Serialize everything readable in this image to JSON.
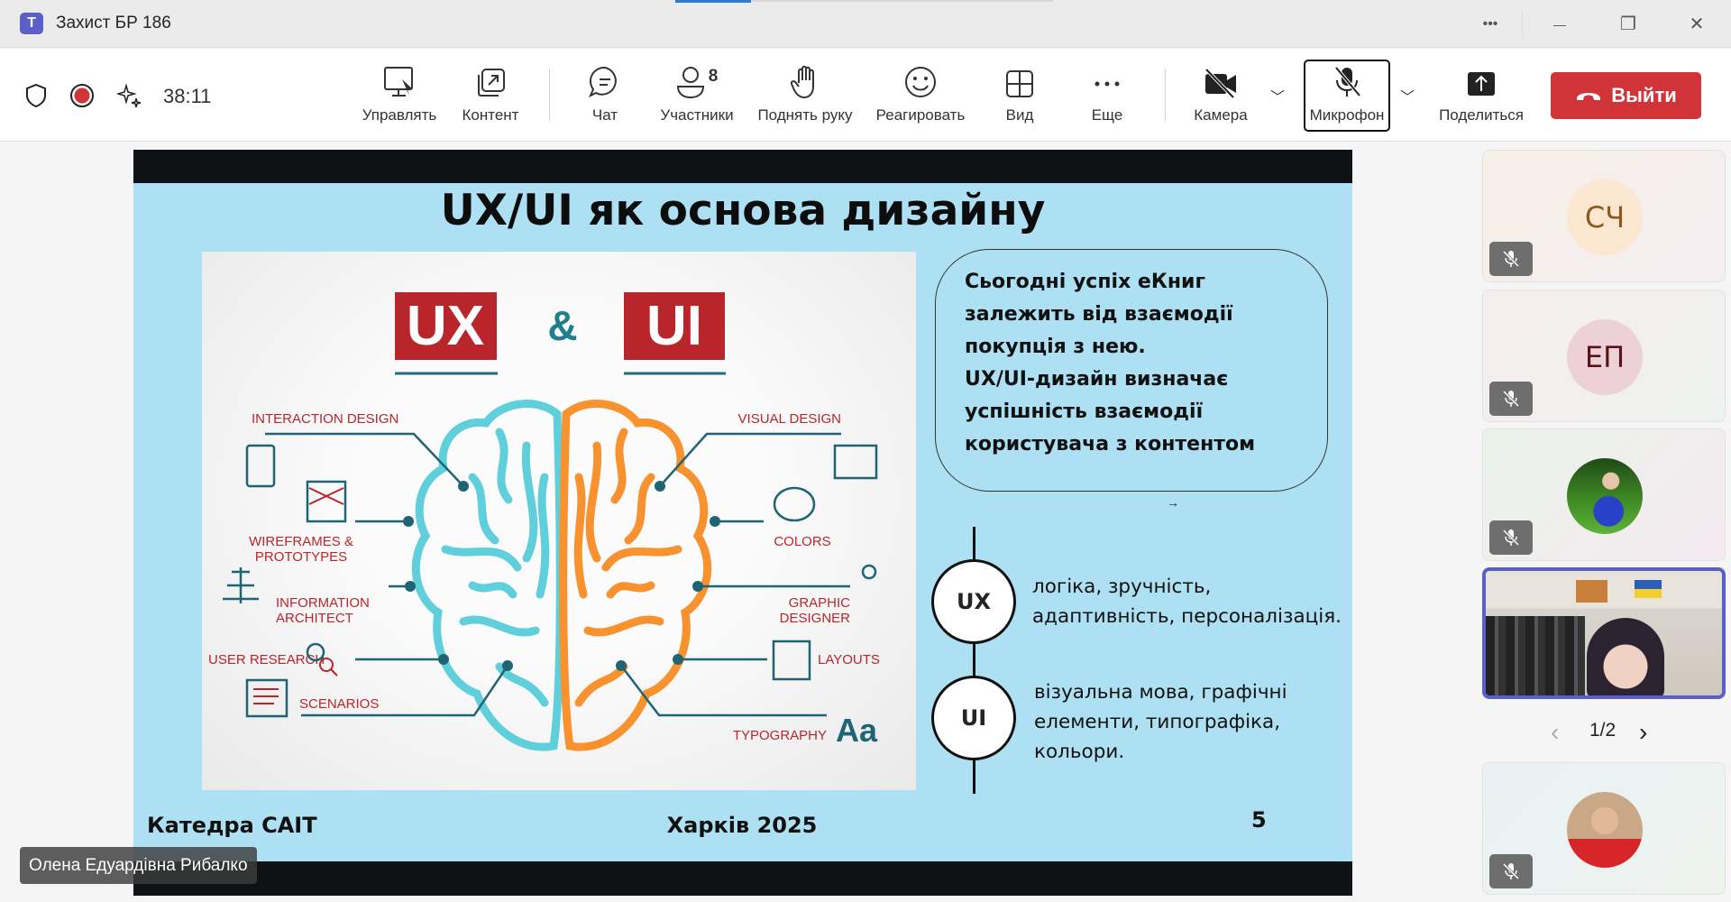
{
  "window": {
    "title": "Захист БР 186",
    "menu": "•••",
    "minimize": "—",
    "restore": "❐",
    "close": "✕"
  },
  "toolbar": {
    "timer": "38:11",
    "manage": "Управлять",
    "content": "Контент",
    "chat": "Чат",
    "participants": "Участники",
    "participants_count": "8",
    "raise_hand": "Поднять руку",
    "react": "Реагировать",
    "view": "Вид",
    "more": "Еще",
    "camera": "Камера",
    "microphone": "Микрофон",
    "share": "Поделиться",
    "leave": "Выйти"
  },
  "slide": {
    "title": "UX/UI як основа дизайну",
    "infographic": {
      "ux": "UX",
      "amp": "&",
      "ui": "UI",
      "labels": {
        "interaction": "INTERACTION DESIGN",
        "wireframes1": "WIREFRAMES &",
        "wireframes2": "PROTOTYPES",
        "info1": "INFORMATION",
        "info2": "ARCHITECT",
        "user_research": "USER RESEARCH",
        "scenarios": "SCENARIOS",
        "visual": "VISUAL DESIGN",
        "colors": "COLORS",
        "graphic1": "GRAPHIC",
        "graphic2": "DESIGNER",
        "layouts": "LAYOUTS",
        "typography": "TYPOGRAPHY",
        "aa": "Aa"
      },
      "colors": {
        "ux_brain": "#5fcfdc",
        "ui_brain": "#f7922f",
        "red": "#b8262c",
        "teal": "#1f6473"
      }
    },
    "box_lines": [
      "Сьогодні успіх еКниг",
      "залежить від взаємодії",
      "покупція з нею.",
      "UX/UI-дизайн визначає",
      "успішність взаємодії",
      "користувача з контентом"
    ],
    "arrow": "→",
    "ux": {
      "label": "UX",
      "lines": [
        " логіка, зручність,",
        "адаптивність, персоналізація."
      ]
    },
    "ui": {
      "label": "UI",
      "lines": [
        "візуальна мова, графічні",
        "елементи, типографіка,",
        "кольори."
      ]
    },
    "footer_left": "Катедра САІТ",
    "footer_center": "Харків 2025",
    "page": "5"
  },
  "presenter_name": "Олена Едуардівна Рибалко",
  "participants": [
    {
      "initials": "СЧ"
    },
    {
      "initials": "ЕП"
    },
    {
      "initials": ""
    },
    {
      "initials": ""
    },
    {
      "initials": ""
    }
  ],
  "pager": {
    "prev": "‹",
    "label": "1/2",
    "next": "›"
  }
}
